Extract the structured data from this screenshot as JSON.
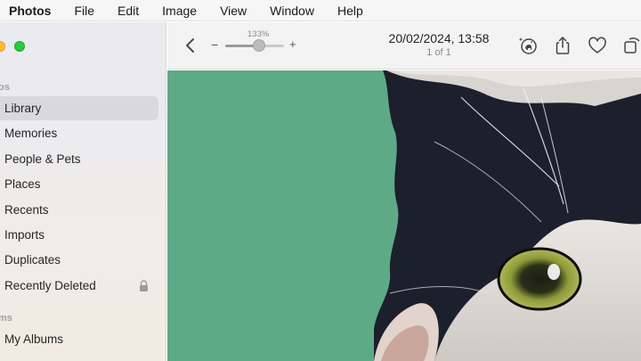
{
  "menubar": {
    "app": "Photos",
    "items": [
      "File",
      "Edit",
      "Image",
      "View",
      "Window",
      "Help"
    ]
  },
  "sidebar": {
    "section_library": "os",
    "items": [
      {
        "label": "Library",
        "selected": true
      },
      {
        "label": "Memories"
      },
      {
        "label": "People & Pets"
      },
      {
        "label": "Places"
      },
      {
        "label": "Recents"
      },
      {
        "label": "Imports"
      },
      {
        "label": "Duplicates"
      },
      {
        "label": "Recently Deleted",
        "icon": "lock-icon"
      }
    ],
    "section_albums": "ms",
    "album_items": [
      {
        "label": "My Albums"
      }
    ]
  },
  "toolbar": {
    "zoom_label": "133%",
    "zoom_minus": "−",
    "zoom_plus": "+",
    "zoom_value": 0.58,
    "date": "20/02/2024, 13:58",
    "count": "1 of 1",
    "icons": [
      "back-chevron-icon",
      "visual-lookup-pet-icon",
      "share-icon",
      "heart-icon",
      "rotate-icon"
    ]
  },
  "colors": {
    "photo_background": "#5eaa86",
    "selection": "#d9d9dd"
  }
}
